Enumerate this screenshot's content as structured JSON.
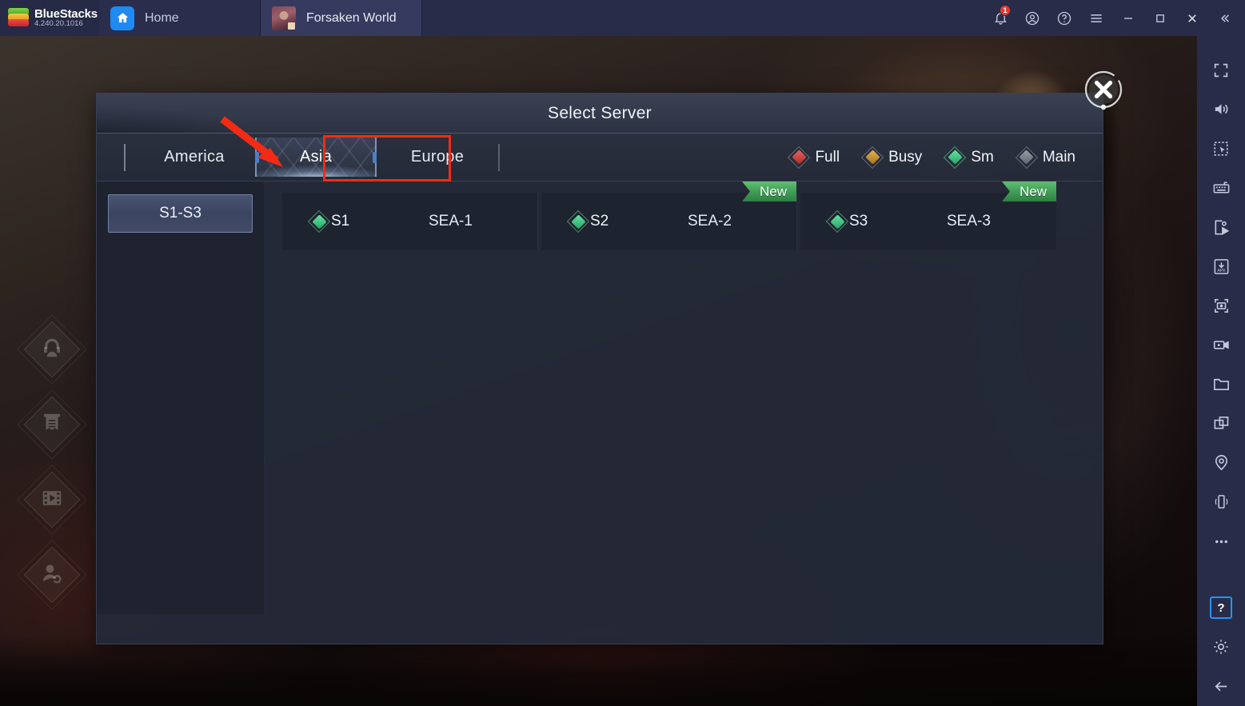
{
  "titlebar": {
    "brand_name": "BlueStacks",
    "version": "4.240.20.1016",
    "tabs": [
      {
        "label": "Home",
        "icon": "home-icon",
        "active": false
      },
      {
        "label": "Forsaken World",
        "icon": "game-thumbnail",
        "active": true
      }
    ],
    "controls": [
      {
        "name": "notifications-button",
        "icon": "bell-icon",
        "badge": "1"
      },
      {
        "name": "account-button",
        "icon": "user-circle-icon"
      },
      {
        "name": "help-button",
        "icon": "question-circle-icon"
      },
      {
        "name": "menu-button",
        "icon": "hamburger-icon"
      },
      {
        "name": "minimize-button",
        "icon": "minimize-icon"
      },
      {
        "name": "maximize-button",
        "icon": "maximize-icon"
      },
      {
        "name": "close-button",
        "icon": "close-icon"
      },
      {
        "name": "collapse-sidebar-button",
        "icon": "double-chevron-left-icon"
      }
    ]
  },
  "right_toolbar": [
    {
      "name": "fullscreen-button",
      "icon": "fullscreen-icon"
    },
    {
      "name": "volume-button",
      "icon": "speaker-icon"
    },
    {
      "name": "region-select-button",
      "icon": "marquee-select-icon"
    },
    {
      "name": "keyboard-controls-button",
      "icon": "keyboard-icon"
    },
    {
      "name": "macro-recorder-button",
      "icon": "script-play-icon"
    },
    {
      "name": "install-apk-button",
      "icon": "apk-download-icon"
    },
    {
      "name": "screenshot-button",
      "icon": "camera-icon"
    },
    {
      "name": "record-screen-button",
      "icon": "video-camera-icon"
    },
    {
      "name": "media-manager-button",
      "icon": "folder-icon"
    },
    {
      "name": "multi-instance-button",
      "icon": "copy-windows-icon"
    },
    {
      "name": "location-button",
      "icon": "map-pin-icon"
    },
    {
      "name": "shake-button",
      "icon": "vibrate-phone-icon"
    },
    {
      "name": "more-button",
      "icon": "ellipsis-icon"
    },
    {
      "name": "help-center-button",
      "icon": "question-mark-icon",
      "label": "?",
      "highlighted": true
    },
    {
      "name": "settings-button",
      "icon": "gear-icon"
    },
    {
      "name": "back-button",
      "icon": "arrow-left-icon"
    }
  ],
  "game_rail": [
    {
      "name": "customer-service-button",
      "icon": "headset-icon"
    },
    {
      "name": "announcement-button",
      "icon": "scroll-notice-icon"
    },
    {
      "name": "media-video-button",
      "icon": "film-play-icon"
    },
    {
      "name": "switch-account-button",
      "icon": "account-switch-icon"
    }
  ],
  "dialog": {
    "title": "Select Server",
    "close_label": "✕",
    "region_tabs": [
      {
        "label": "America",
        "active": false
      },
      {
        "label": "Asia",
        "active": true
      },
      {
        "label": "Europe",
        "active": false
      }
    ],
    "legend": [
      {
        "label": "Full",
        "color": "#d6423f"
      },
      {
        "label": "Busy",
        "color": "#d29a32"
      },
      {
        "label": "Sm",
        "color": "#3fcb80"
      },
      {
        "label": "Main",
        "color": "#7e8590"
      }
    ],
    "groups": [
      {
        "label": "S1-S3",
        "selected": true
      }
    ],
    "servers": [
      {
        "id": "S1",
        "name": "SEA-1",
        "status": "Sm",
        "status_color": "#3fcb80",
        "badge": ""
      },
      {
        "id": "S2",
        "name": "SEA-2",
        "status": "Sm",
        "status_color": "#3fcb80",
        "badge": "New"
      },
      {
        "id": "S3",
        "name": "SEA-3",
        "status": "Sm",
        "status_color": "#3fcb80",
        "badge": "New"
      }
    ]
  },
  "annotation": {
    "arrow_color": "#f32b14",
    "highlight_color": "#f32b14",
    "target": "Asia"
  }
}
